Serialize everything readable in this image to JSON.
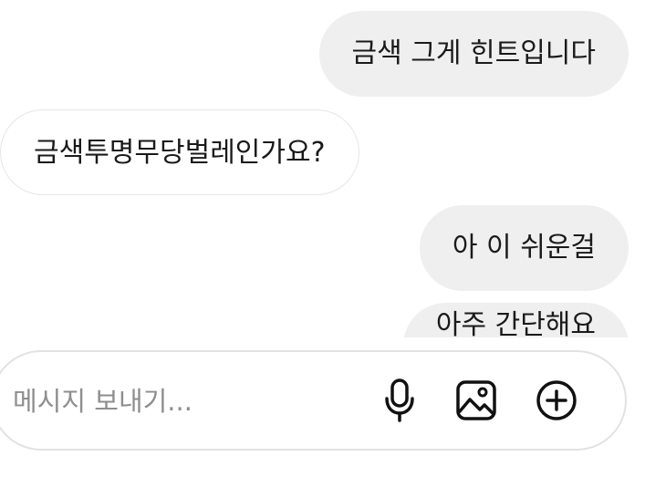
{
  "conversation": {
    "messages": [
      {
        "direction": "sent",
        "text": "금색 그게 힌트입니다"
      },
      {
        "direction": "received",
        "text": "금색투명무당벌레인가요?"
      },
      {
        "direction": "sent",
        "text": "아 이 쉬운걸"
      },
      {
        "direction": "sent",
        "text": "아주 간단해요"
      }
    ]
  },
  "composer": {
    "placeholder": "메시지 보내기...",
    "value": "",
    "icons": [
      "microphone-icon",
      "image-icon",
      "add-circle-icon"
    ]
  },
  "colors": {
    "sent_bubble": "#efefef",
    "received_bubble": "#ffffff",
    "text": "#1a1a1a",
    "placeholder": "#8e8e8e"
  }
}
